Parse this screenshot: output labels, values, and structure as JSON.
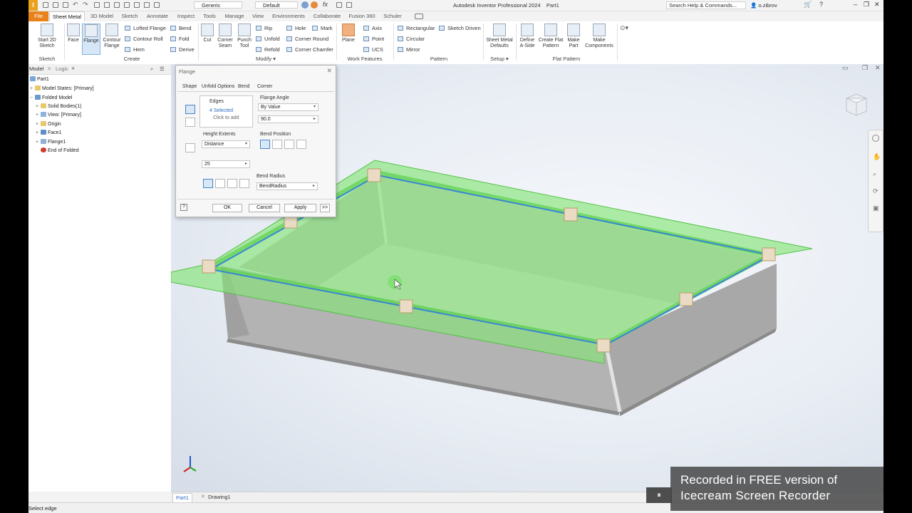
{
  "title_bar": {
    "app_title": "Autodesk Inventor Professional 2024",
    "doc_name": "Part1",
    "material": "Generic",
    "appearance": "Default",
    "search_placeholder": "Search Help & Commands...",
    "user": "o.zibrov"
  },
  "tabs": [
    "File",
    "Sheet Metal",
    "3D Model",
    "Sketch",
    "Annotate",
    "Inspect",
    "Tools",
    "Manage",
    "View",
    "Environments",
    "Collaborate",
    "Fusion 360",
    "Schuler"
  ],
  "active_tab": "Sheet Metal",
  "ribbon": {
    "sketch": {
      "start_2d_sketch": "Start 2D Sketch",
      "group": "Sketch"
    },
    "create": {
      "face": "Face",
      "flange": "Flange",
      "contour_flange": "Contour Flange",
      "lofted_flange": "Lofted Flange",
      "contour_roll": "Contour Roll",
      "hem": "Hem",
      "bend": "Bend",
      "fold": "Fold",
      "derive": "Derive",
      "group": "Create"
    },
    "modify": {
      "cut": "Cut",
      "corner_seam": "Corner Seam",
      "punch_tool": "Punch Tool",
      "rip": "Rip",
      "unfold": "Unfold",
      "refold": "Refold",
      "hole": "Hole",
      "corner_round": "Corner Round",
      "corner_chamfer": "Corner Chamfer",
      "mark": "Mark",
      "group": "Modify"
    },
    "work_features": {
      "plane": "Plane",
      "axis": "Axis",
      "point": "Point",
      "ucs": "UCS",
      "group": "Work Features"
    },
    "pattern": {
      "rectangular": "Rectangular",
      "circular": "Circular",
      "mirror": "Mirror",
      "sketch_driven": "Sketch Driven",
      "group": "Pattern"
    },
    "setup": {
      "sheet_metal_defaults": "Sheet Metal Defaults",
      "group": "Setup"
    },
    "flat_pattern": {
      "define_a_side": "Define A-Side",
      "create_flat_pattern": "Create Flat Pattern",
      "make_part": "Make Part",
      "make_components": "Make Components",
      "group": "Flat Pattern"
    }
  },
  "browser": {
    "tabs": [
      "Model",
      "Logic"
    ],
    "tree": [
      {
        "label": "Part1",
        "level": 0
      },
      {
        "label": "Model States: [Primary]",
        "level": 1
      },
      {
        "label": "Folded Model",
        "level": 0
      },
      {
        "label": "Solid Bodies(1)",
        "level": 1
      },
      {
        "label": "View: [Primary]",
        "level": 1
      },
      {
        "label": "Origin",
        "level": 1
      },
      {
        "label": "Face1",
        "level": 1
      },
      {
        "label": "Flange1",
        "level": 1
      },
      {
        "label": "End of Folded",
        "level": 1
      }
    ]
  },
  "dialog": {
    "title": "Flange",
    "tabs": [
      "Shape",
      "Unfold Options",
      "Bend",
      "Corner"
    ],
    "edges_label": "Edges",
    "edges_selected": "4 Selected",
    "edges_hint": "Click to add",
    "flange_angle_label": "Flange Angle",
    "flange_angle_mode": "By Value",
    "flange_angle_value": "90.0",
    "height_extents_label": "Height Extents",
    "height_extents_mode": "Distance",
    "height_value": "25",
    "bend_position_label": "Bend Position",
    "bend_radius_label": "Bend Radius",
    "bend_radius_value": "BendRadius",
    "ok": "OK",
    "cancel": "Cancel",
    "apply": "Apply",
    "more": ">>"
  },
  "doc_tabs": [
    "Part1",
    "Drawing1"
  ],
  "status_text": "Select edge",
  "watermark": {
    "line1": "Recorded in FREE version of",
    "line2": "Icecream  Screen  Recorder"
  },
  "colors": {
    "file_tab": "#e9821c",
    "flange_green": "#7be06b",
    "edge_blue": "#3a86d6",
    "part_gray": "#b8b8b8"
  }
}
